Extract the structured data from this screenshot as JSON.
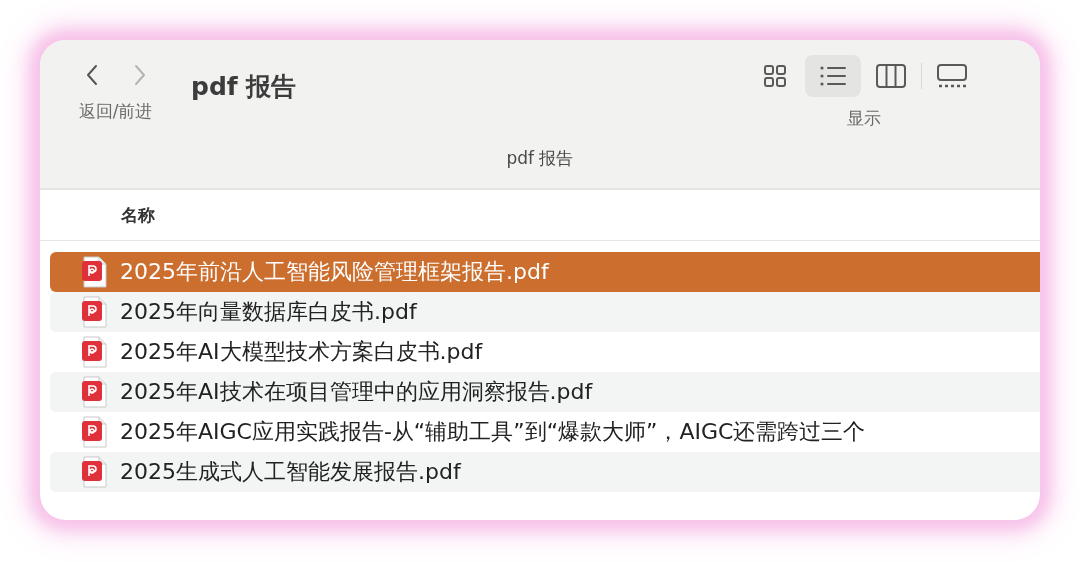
{
  "toolbar": {
    "back": {
      "disabled": false
    },
    "forward": {
      "disabled": true
    },
    "nav_label": "返回/前进",
    "title": "pdf 报告",
    "views": [
      {
        "kind": "icons",
        "selected": false
      },
      {
        "kind": "list",
        "selected": true
      },
      {
        "kind": "columns",
        "selected": false
      },
      {
        "kind": "gallery",
        "selected": false
      }
    ],
    "views_label": "显示"
  },
  "path_bar": "pdf 报告",
  "table": {
    "columns": [
      "名称"
    ],
    "rows": [
      {
        "name": "2025年前沿人工智能风险管理框架报告.pdf",
        "selected": true
      },
      {
        "name": "2025年向量数据库白皮书.pdf",
        "selected": false
      },
      {
        "name": "2025年AI大模型技术方案白皮书.pdf",
        "selected": false
      },
      {
        "name": "2025年AI技术在项目管理中的应用洞察报告.pdf",
        "selected": false
      },
      {
        "name": "2025年AIGC应用实践报告-从“辅助工具”到“爆款大师”，AIGC还需跨过三个",
        "selected": false
      },
      {
        "name": "2025生成式人工智能发展报告.pdf",
        "selected": false
      }
    ]
  }
}
